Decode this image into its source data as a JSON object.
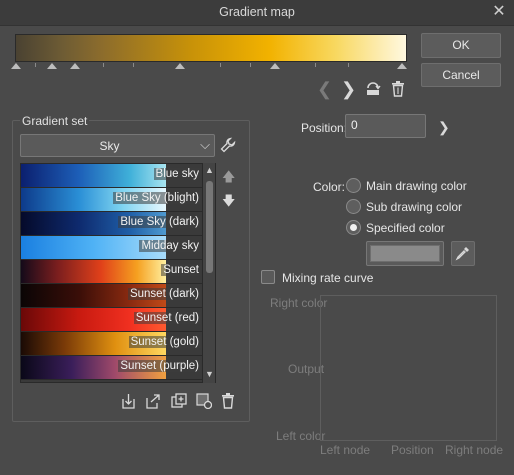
{
  "window": {
    "title": "Gradient map"
  },
  "buttons": {
    "ok": "OK",
    "cancel": "Cancel"
  },
  "gradient_set": {
    "label": "Gradient set",
    "selected": "Sky",
    "items": [
      {
        "name": "Blue sky"
      },
      {
        "name": "Blue Sky (blight)"
      },
      {
        "name": "Blue Sky (dark)"
      },
      {
        "name": "Midday sky"
      },
      {
        "name": "Sunset"
      },
      {
        "name": "Sunset (dark)"
      },
      {
        "name": "Sunset (red)"
      },
      {
        "name": "Sunset (gold)"
      },
      {
        "name": "Sunset (purple)"
      }
    ]
  },
  "position": {
    "label": "Position:",
    "value": "0"
  },
  "color": {
    "label": "Color:",
    "options": [
      "Main drawing color",
      "Sub drawing color",
      "Specified color"
    ],
    "selected": "Specified color"
  },
  "mixing": {
    "label": "Mixing rate curve"
  },
  "graph": {
    "right_color": "Right color",
    "output": "Output",
    "left_color": "Left color",
    "left_node": "Left node",
    "position": "Position",
    "right_node": "Right node"
  }
}
